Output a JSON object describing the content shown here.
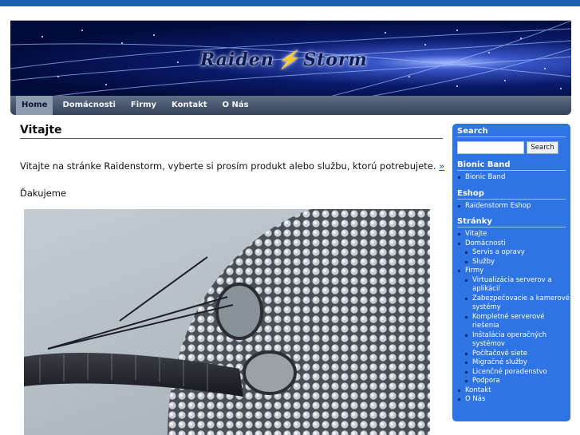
{
  "site": {
    "logo_left": "Raiden",
    "logo_right": "Storm"
  },
  "nav": {
    "items": [
      "Home",
      "Domácnosti",
      "Firmy",
      "Kontakt",
      "O Nás"
    ],
    "active": "Home"
  },
  "main": {
    "title": "Vitajte",
    "intro": "Vitajte na stránke Raidenstorm, vyberte si prosím produkt alebo službu, ktorú potrebujete.",
    "intro_link": "»",
    "thanks": "Ďakujeme"
  },
  "sidebar": {
    "search": {
      "title": "Search",
      "value": "",
      "button": "Search"
    },
    "bionic": {
      "title": "Bionic Band",
      "items": [
        "Bionic Band"
      ]
    },
    "eshop": {
      "title": "Eshop",
      "items": [
        "Raidenstorm Eshop"
      ]
    },
    "pages": {
      "title": "Stránky",
      "items": [
        "Vitajte",
        "Domácnosti",
        "Servis a opravy",
        "Služby",
        "Firmy",
        "Virtualizácia serverov a aplikácií",
        "Zabezpečovacie a kamerové systémy",
        "Kompletné serverové riešenia",
        "Inštalácia operačných systémov",
        "Počítačové siete",
        "Migračné služby",
        "Licenčné poradenstvo",
        "Podpora",
        "Kontakt",
        "O Nás"
      ]
    }
  },
  "colors": {
    "sidebar": "#2e74e4",
    "nav": "#4a5870",
    "topbar": "#1a5fb0"
  }
}
